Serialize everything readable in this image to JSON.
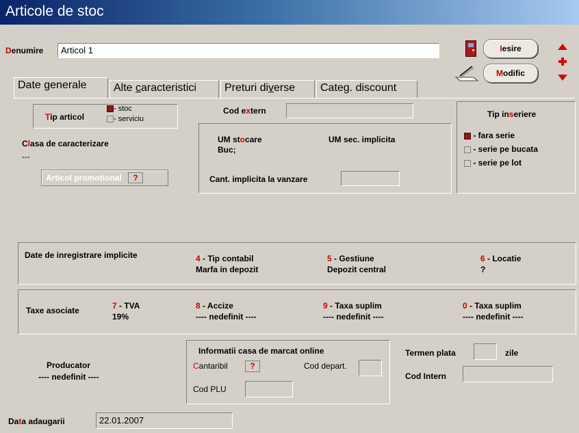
{
  "window": {
    "title": "Articole de stoc"
  },
  "header": {
    "name_label_first": "D",
    "name_label_rest": "enumire",
    "name_value": "Articol 1",
    "exit_first": "I",
    "exit_rest": "esire",
    "modify_first": "M",
    "modify_rest": "odific"
  },
  "tabs": [
    {
      "pre": "Date ",
      "u": "g",
      "post": "enerale"
    },
    {
      "pre": "Alte ",
      "u": "c",
      "post": "aracteristici"
    },
    {
      "pre": "Preturi di",
      "u": "v",
      "post": "erse"
    },
    {
      "pre": "Categ. discount",
      "u": "",
      "post": ""
    }
  ],
  "tip_articol": {
    "label_first": "T",
    "label_rest": "ip articol",
    "opt1": "- stoc",
    "opt2": "- serviciu"
  },
  "clasa": {
    "label_pre": "C",
    "label_red": "l",
    "label_post": "asa de caracterizare",
    "value": "---"
  },
  "promo": {
    "label": "Articol promotional",
    "q": "?"
  },
  "cod_extern": {
    "pre": "Cod e",
    "red": "x",
    "post": "tern",
    "value": ""
  },
  "um": {
    "stocare_pre": "UM st",
    "stocare_red": "o",
    "stocare_post": "care",
    "stocare_value": "Buc;",
    "sec_label": "UM sec. implicita",
    "cant_label": "Cant. implicita la vanzare",
    "cant_value": ""
  },
  "tip_inseriere": {
    "title_pre": "Tip in",
    "title_red": "s",
    "title_post": "eriere",
    "o1": "- fara serie",
    "o2": "- serie pe bucata",
    "o3": "- serie pe lot"
  },
  "inregistrare": {
    "label": "Date de inregistrare implicite",
    "c1_num": "4",
    "c1_label": " - Tip contabil",
    "c1_value": "Marfa in depozit",
    "c2_num": "5",
    "c2_label": " - Gestiune",
    "c2_value": "Depozit central",
    "c3_num": "6",
    "c3_label": " - Locatie",
    "c3_value": "?"
  },
  "taxe": {
    "label": "Taxe asociate",
    "t1_num": "7",
    "t1_label": " - TVA",
    "t1_value": "19%",
    "t2_num": "8",
    "t2_label": " - Accize",
    "t2_value": "---- nedefinit ----",
    "t3_num": "9",
    "t3_label": " - Taxa suplim",
    "t3_value": "---- nedefinit ----",
    "t4_num": "0",
    "t4_label": " - Taxa suplim",
    "t4_value": "---- nedefinit ----"
  },
  "producator": {
    "label": "Producator",
    "value": "---- nedefinit ----"
  },
  "casa_marcat": {
    "title": "Informatii casa de marcat online",
    "cantaribil_first": "C",
    "cantaribil_rest": "antaribil",
    "q": "?",
    "cod_depart": "Cod depart.",
    "cod_plu": "Cod PLU"
  },
  "termen": {
    "label": "Termen plata",
    "unit": "zile",
    "value": ""
  },
  "cod_intern": {
    "label": "Cod Intern",
    "value": ""
  },
  "data_adaugarii": {
    "l1": "Da",
    "l_red": "t",
    "l2": "a adaugarii",
    "value": "22.01.2007"
  },
  "colors": {
    "accent_red": "#d00000",
    "title_bar": "#0a246a",
    "face": "#d4d0c8"
  }
}
